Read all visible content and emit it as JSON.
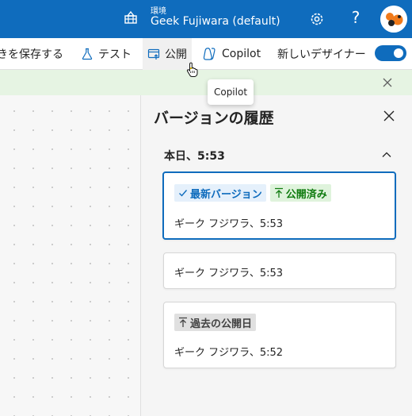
{
  "topbar": {
    "env_label": "環境",
    "env_name": "Geek Fujiwara (default)",
    "help_symbol": "?",
    "brand_color": "#0f6cbd"
  },
  "toolbar": {
    "save_label": "きを保存する",
    "test_label": "テスト",
    "publish_label": "公開",
    "copilot_label": "Copilot",
    "new_designer_label": "新しいデザイナー",
    "new_designer_enabled": true
  },
  "tooltip": {
    "text": "Copilot"
  },
  "version_history": {
    "title": "バージョンの履歴",
    "group_title": "本日、5:53",
    "cards": [
      {
        "badges": [
          "最新バージョン",
          "公開済み"
        ],
        "author_time": "ギーク フジワラ、5:53",
        "selected": true
      },
      {
        "badges": [],
        "author_time": "ギーク フジワラ、5:53",
        "selected": false
      },
      {
        "badges": [
          "過去の公開日"
        ],
        "author_time": "ギーク フジワラ、5:52",
        "selected": false
      }
    ]
  },
  "icons": [
    "environment-icon",
    "settings-icon",
    "help-icon",
    "avatar",
    "save-icon",
    "flask-icon",
    "publish-icon",
    "copilot-icon",
    "close-icon",
    "chevron-up-icon",
    "check-icon",
    "arrow-up-icon"
  ]
}
